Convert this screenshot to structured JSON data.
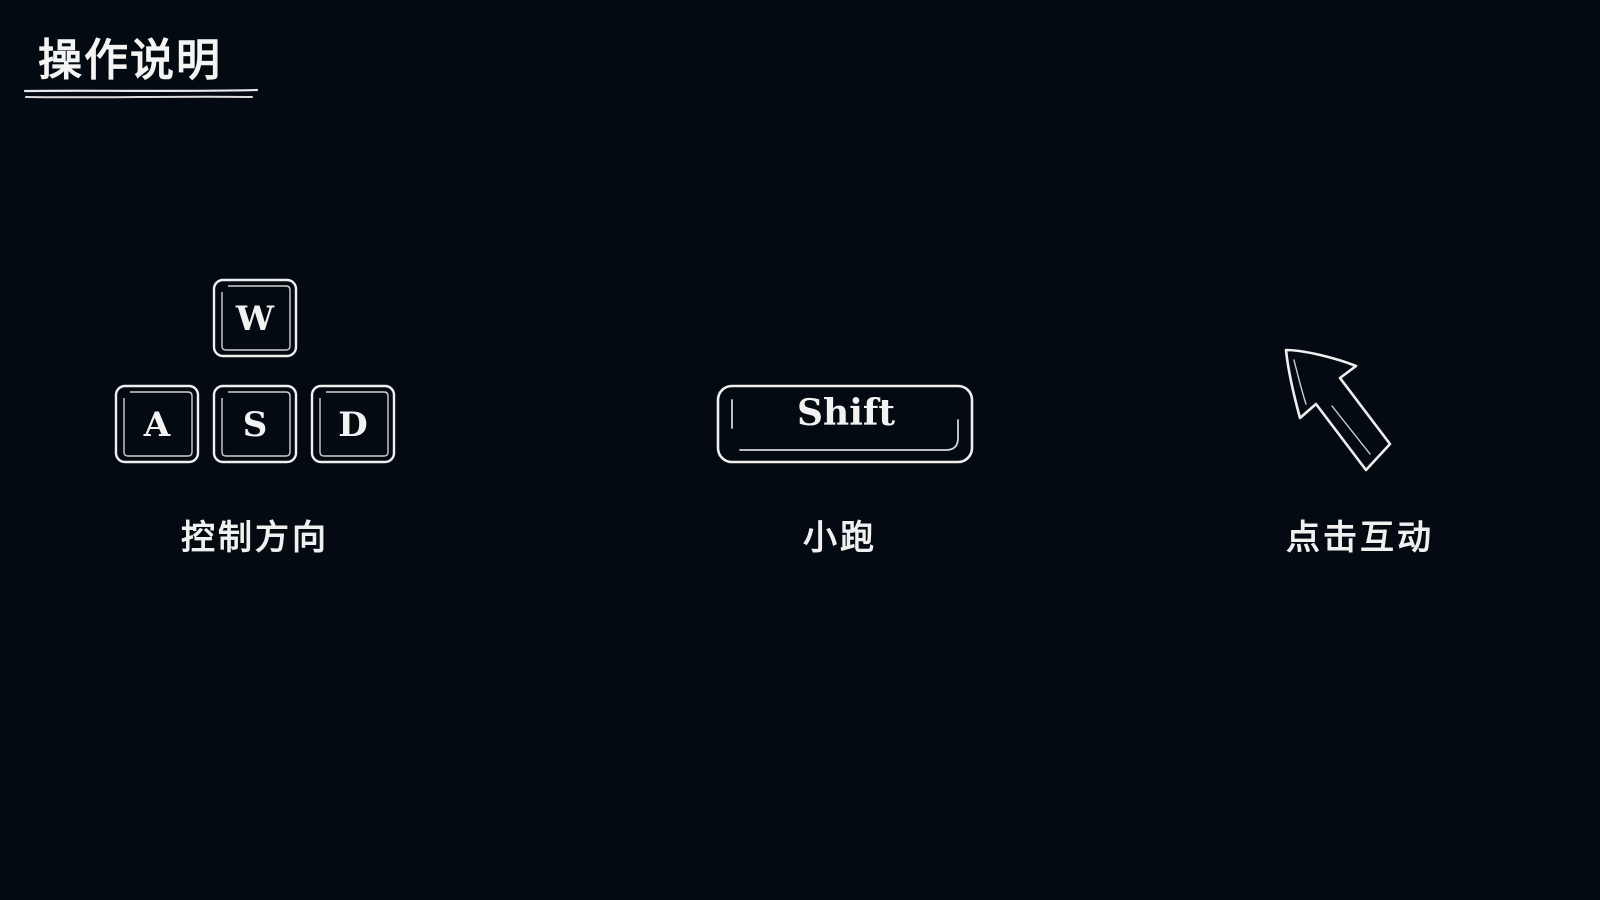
{
  "screen": {
    "title": "操作说明",
    "background_color": "#040a11",
    "foreground_color": "#f2f2f2"
  },
  "controls": [
    {
      "id": "move",
      "keys": [
        "W",
        "A",
        "S",
        "D"
      ],
      "caption": "控制方向"
    },
    {
      "id": "run",
      "keys": [
        "Shift"
      ],
      "caption": "小跑"
    },
    {
      "id": "interact",
      "icon": "mouse-cursor-icon",
      "caption": "点击互动"
    }
  ]
}
